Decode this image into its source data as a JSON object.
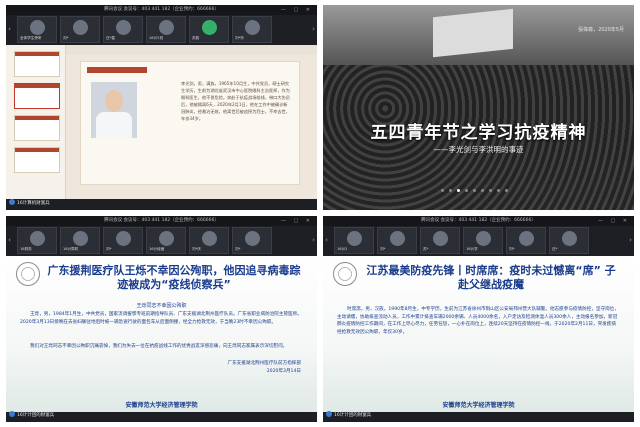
{
  "meeting": {
    "title_q1": "腾讯会议 会议号：403 441 182（企业预约：666666）",
    "title_q3": "腾讯会议 会议号：403 441 182（企业预约：666666）",
    "title_q4": "腾讯会议 会议号：403 441 182（企业预约：666666）",
    "window_controls": "— ▢ ✕",
    "tiles_q1": [
      "全体学生旁听",
      "刘*",
      "庄*嘉",
      "16计2班",
      "苏韵",
      "刘*玲"
    ],
    "tiles_q3": [
      "16财务",
      "16计算机",
      "刘*",
      "16计经营",
      "刘*庆",
      "刘*"
    ],
    "tiles_q4": [
      "16计2",
      "刘*",
      "苏*",
      "16计学",
      "刘*",
      "庄*"
    ],
    "arrow_left": "‹",
    "arrow_right": "›",
    "presenter_q1": "16计算机财富兵",
    "presenter_q3": "16计计团的财富兵",
    "presenter_q4": "16计计团的财富兵"
  },
  "slide1": {
    "bio": "李光剑，男，满族，1965年10月生，中共党员，硕士研究生学历，生前为湖北省武汉市中心医院眼科主治医师，作为眼科医生，他不畏危险，奔赴于抗疫战场前线，带口大伤员后，他被隔离6天，2020年2月1日，他在工作中被确诊新冠肺炎，经救治无效，他离世后被追授为烈士，不幸去世，年仅34岁。"
  },
  "slide2": {
    "date": "張偉森，2020年5月",
    "title": "五四青年节之学习抗疫精神",
    "subtitle": "——李光剑与李洪明的事迹",
    "dots": 9,
    "active_dot": 2
  },
  "slide3": {
    "title": "广东援荆医疗队王烁不幸因公殉职，他因追寻病毒踪迹被成为“疫线侦察兵”",
    "subhead": "王烁同志不幸因公殉职",
    "body1": "王烁，男，1984年1月生，中共党员，国家流调援鄂专班前期指导队员、广东支援湖北荆州医疗队员。广东省职业病防治院主管医师。2020年3月13日傍晚在去省妇联驻地后时被一辆急速行驶的面包车从后面侧撞，经全力抢救无效，于当晚23时不幸因公殉职。",
    "body2": "我们对王烁同志不幸因公殉职沉痛哀悼，我们为失去一位在抗疫战线工作的优秀战友深感悲痛，向王烁同志家属表示深切慰问。",
    "sign1": "广东支援湖北荆州医疗队前方指挥部",
    "sign2": "2020年3月14日",
    "school": "安徽师范大学经济管理学院"
  },
  "slide4": {
    "title": "江苏最美防疫先锋丨时席席：疫时未过憾离“席”  子赴父继战疫魔",
    "body1": "时席席，男，汉族，1990年8月生，中专学历，生前为江苏省徐州市铜山区公安局邳州营大队辅警。他志愿参与疫情防控，坚守岗位，主动请缨，协助排查流动人员，工作中累计排查车辆2000余辆、人员4000余名，入户走访及检测体温人员300余人，主动报名参加，新冠肺炎疫情防控工作期间，在工作上尽心尽力，任劳任怨，一心扑在岗位上，连续20天坚持在疫情防控一线，于2020年2月11日，突发疾病经抢救无效因公殉职，年仅30岁。",
    "school": "安徽师范大学经济管理学院"
  }
}
